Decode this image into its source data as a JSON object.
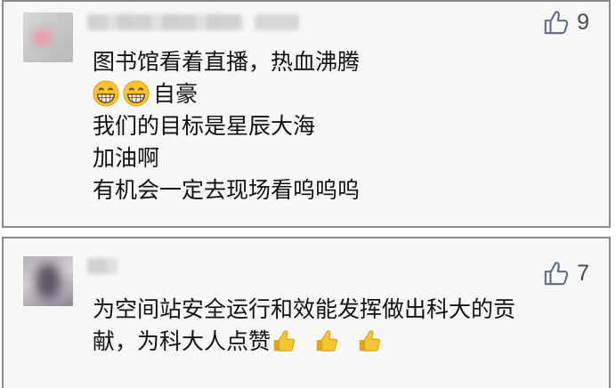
{
  "comments": [
    {
      "like_count": "9",
      "lines": [
        "图书馆看着直播，热血沸腾",
        "自豪",
        "我们的目标是星辰大海",
        "加油啊",
        "有机会一定去现场看呜呜呜"
      ],
      "line2_emoji": "grinning-face-icon"
    },
    {
      "like_count": "7",
      "lines": [
        "为空间站安全运行和效能发挥做出科大的贡",
        "献，为科大人点赞"
      ],
      "line2_emoji": "thumbs-up-icon"
    }
  ],
  "colors": {
    "card_bg": "#f7f7f7",
    "card_border": "#8a8a8a",
    "like_icon": "#5b6b86",
    "emoji_yellow": "#f7c52b"
  }
}
